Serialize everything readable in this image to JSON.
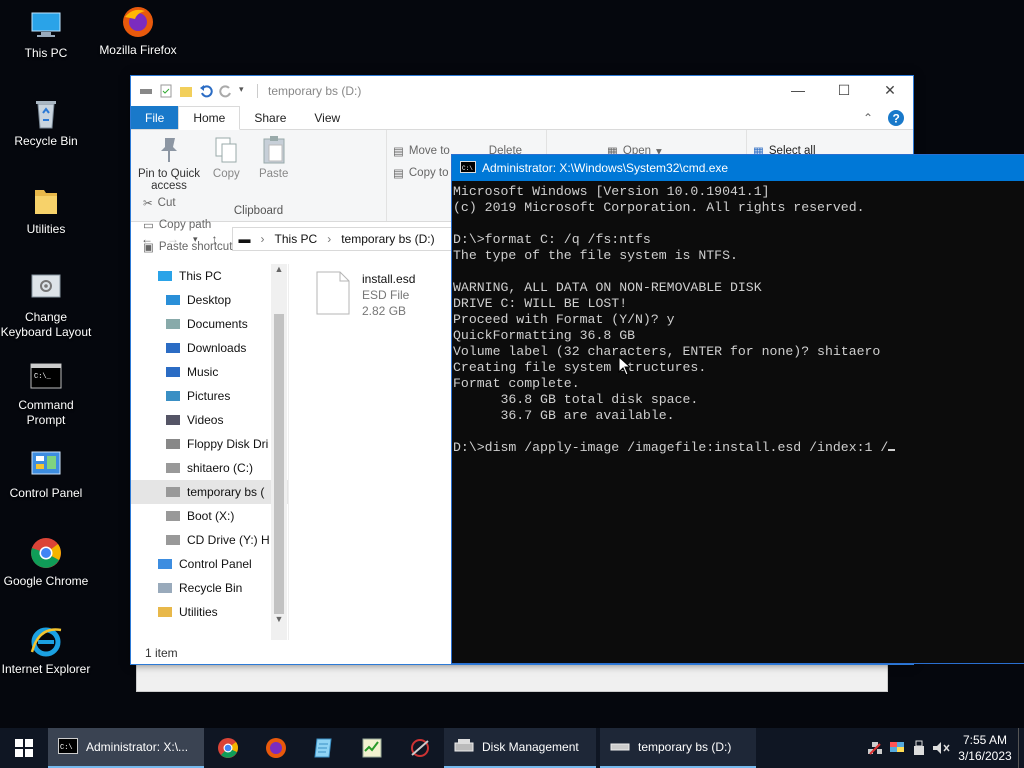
{
  "desktop": {
    "icons": [
      {
        "label": "This PC"
      },
      {
        "label": "Mozilla Firefox"
      },
      {
        "label": "Recycle Bin"
      },
      {
        "label": "Utilities"
      },
      {
        "label": "Change Keyboard Layout"
      },
      {
        "label": "Command Prompt"
      },
      {
        "label": "Control Panel"
      },
      {
        "label": "Google Chrome"
      },
      {
        "label": "Internet Explorer"
      }
    ]
  },
  "explorer": {
    "title": "temporary bs (D:)",
    "tabs": [
      "File",
      "Home",
      "Share",
      "View"
    ],
    "ribbon": {
      "pin_label": "Pin to Quick access",
      "copy_label": "Copy",
      "paste_label": "Paste",
      "cut_label": "Cut",
      "copy_path_label": "Copy path",
      "paste_shortcut_label": "Paste shortcut",
      "clipboard_group": "Clipboard",
      "move_to_label": "Move to",
      "copy_to_label": "Copy to",
      "delete_label": "Delete",
      "open_label": "Open",
      "select_all_label": "Select all"
    },
    "address": {
      "seg1": "This PC",
      "seg2": "temporary bs (D:)"
    },
    "nav": [
      {
        "label": "This PC",
        "indent": 0
      },
      {
        "label": "Desktop",
        "indent": 1
      },
      {
        "label": "Documents",
        "indent": 1
      },
      {
        "label": "Downloads",
        "indent": 1
      },
      {
        "label": "Music",
        "indent": 1
      },
      {
        "label": "Pictures",
        "indent": 1
      },
      {
        "label": "Videos",
        "indent": 1
      },
      {
        "label": "Floppy Disk Dri",
        "indent": 1
      },
      {
        "label": "shitaero (C:)",
        "indent": 1
      },
      {
        "label": "temporary bs (",
        "indent": 1,
        "selected": true
      },
      {
        "label": "Boot (X:)",
        "indent": 1
      },
      {
        "label": "CD Drive (Y:) H",
        "indent": 1
      },
      {
        "label": "Control Panel",
        "indent": 0
      },
      {
        "label": "Recycle Bin",
        "indent": 0
      },
      {
        "label": "Utilities",
        "indent": 0
      }
    ],
    "file": {
      "name": "install.esd",
      "type": "ESD File",
      "size": "2.82 GB"
    },
    "status": "1 item"
  },
  "cmd": {
    "title": "Administrator: X:\\Windows\\System32\\cmd.exe",
    "lines": [
      "Microsoft Windows [Version 10.0.19041.1]",
      "(c) 2019 Microsoft Corporation. All rights reserved.",
      "",
      "D:\\>format C: /q /fs:ntfs",
      "The type of the file system is NTFS.",
      "",
      "WARNING, ALL DATA ON NON-REMOVABLE DISK",
      "DRIVE C: WILL BE LOST!",
      "Proceed with Format (Y/N)? y",
      "QuickFormatting 36.8 GB",
      "Volume label (32 characters, ENTER for none)? shitaero",
      "Creating file system structures.",
      "Format complete.",
      "      36.8 GB total disk space.",
      "      36.7 GB are available.",
      "",
      "D:\\>dism /apply-image /imagefile:install.esd /index:1 /"
    ]
  },
  "taskbar": {
    "tasks": [
      {
        "label": "Administrator: X:\\..."
      },
      {
        "label": "Disk Management"
      },
      {
        "label": "temporary bs (D:)"
      }
    ],
    "time": "7:55 AM",
    "date": "3/16/2023"
  }
}
